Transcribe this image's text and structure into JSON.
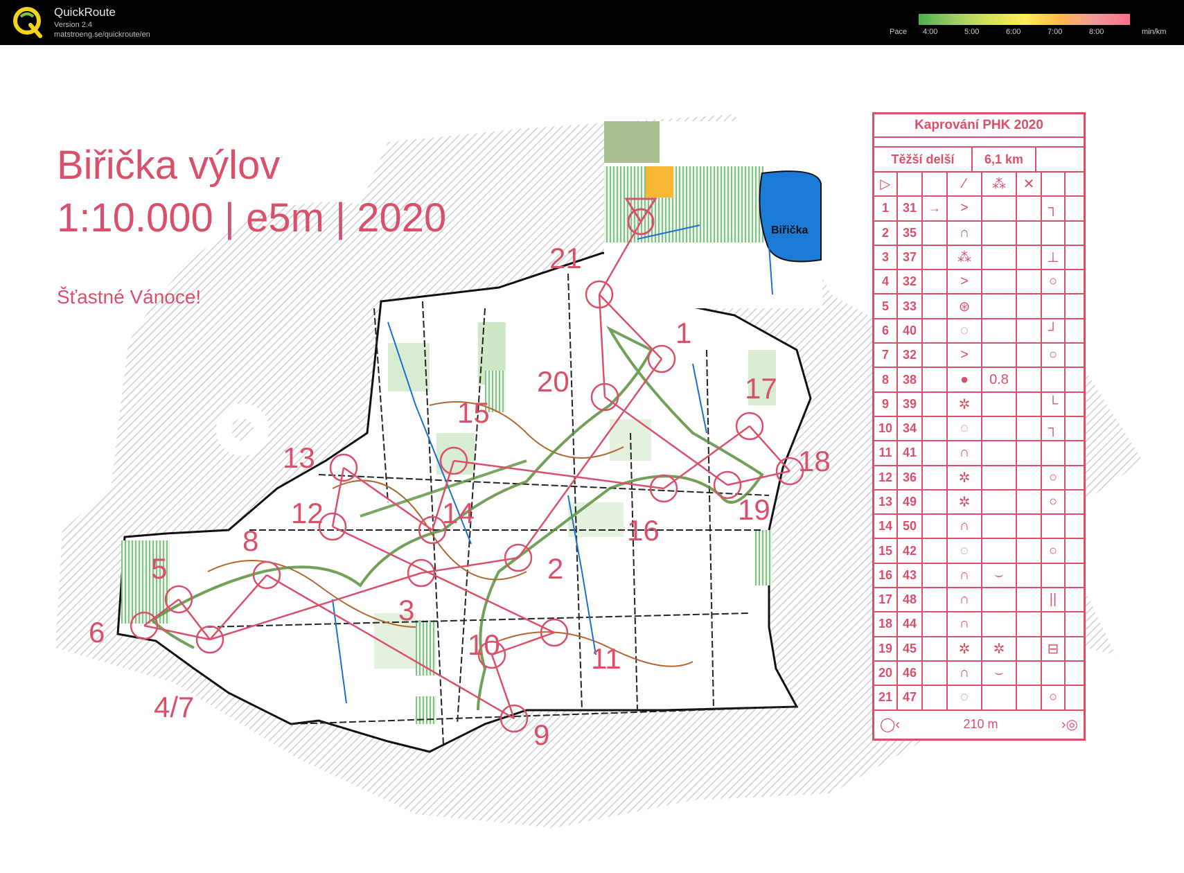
{
  "app": {
    "name": "QuickRoute",
    "version": "Version 2.4",
    "url": "matstroeng.se/quickroute/en"
  },
  "pace_scale": {
    "label": "Pace",
    "ticks": [
      "4:00",
      "5:00",
      "6:00",
      "7:00",
      "8:00"
    ],
    "unit": "min/km"
  },
  "map": {
    "title": "Biřička výlov",
    "subtitle": "1:10.000 | e5m | 2020",
    "greeting": "Šťastné Vánoce!",
    "lake_label": "Biřička",
    "control_labels": [
      "1",
      "2",
      "3",
      "4/7",
      "5",
      "6",
      "8",
      "9",
      "10",
      "11",
      "12",
      "13",
      "14",
      "15",
      "16",
      "17",
      "18",
      "19",
      "20",
      "21"
    ],
    "colors": {
      "overprint": "#d9506a",
      "route": "#5a8f3c",
      "forest": "#2f9a46",
      "water": "#1a6fd1"
    }
  },
  "description_sheet": {
    "event": "Kaprování PHK 2020",
    "class": "Těžší delší",
    "length": "6,1 km",
    "rows": [
      {
        "n": "1",
        "code": "31",
        "d": "→",
        "f": ">",
        "g": "",
        "h": "┐"
      },
      {
        "n": "2",
        "code": "35",
        "d": "",
        "f": "∩",
        "g": "",
        "h": ""
      },
      {
        "n": "3",
        "code": "37",
        "d": "",
        "f": "⁂",
        "g": "",
        "h": "⊥"
      },
      {
        "n": "4",
        "code": "32",
        "d": "",
        "f": ">",
        "g": "",
        "h": "○"
      },
      {
        "n": "5",
        "code": "33",
        "d": "",
        "f": "⊛",
        "g": "",
        "h": ""
      },
      {
        "n": "6",
        "code": "40",
        "d": "",
        "f": "◌",
        "g": "",
        "h": "┘"
      },
      {
        "n": "7",
        "code": "32",
        "d": "",
        "f": ">",
        "g": "",
        "h": "○"
      },
      {
        "n": "8",
        "code": "38",
        "d": "",
        "f": "●",
        "g": "0.8",
        "h": ""
      },
      {
        "n": "9",
        "code": "39",
        "d": "",
        "f": "✲",
        "g": "",
        "h": "└"
      },
      {
        "n": "10",
        "code": "34",
        "d": "",
        "f": "◌",
        "g": "",
        "h": "┐"
      },
      {
        "n": "11",
        "code": "41",
        "d": "",
        "f": "∩",
        "g": "",
        "h": ""
      },
      {
        "n": "12",
        "code": "36",
        "d": "",
        "f": "✲",
        "g": "",
        "h": "○"
      },
      {
        "n": "13",
        "code": "49",
        "d": "",
        "f": "✲",
        "g": "",
        "h": "○"
      },
      {
        "n": "14",
        "code": "50",
        "d": "",
        "f": "∩",
        "g": "",
        "h": ""
      },
      {
        "n": "15",
        "code": "42",
        "d": "",
        "f": "◌",
        "g": "",
        "h": "○"
      },
      {
        "n": "16",
        "code": "43",
        "d": "",
        "f": "∩",
        "g": "⌣",
        "h": ""
      },
      {
        "n": "17",
        "code": "48",
        "d": "",
        "f": "∩",
        "g": "",
        "h": "||"
      },
      {
        "n": "18",
        "code": "44",
        "d": "",
        "f": "∩",
        "g": "",
        "h": ""
      },
      {
        "n": "19",
        "code": "45",
        "d": "",
        "f": "✲",
        "g": "✲",
        "h": "⊟"
      },
      {
        "n": "20",
        "code": "46",
        "d": "",
        "f": "∩",
        "g": "⌣",
        "h": ""
      },
      {
        "n": "21",
        "code": "47",
        "d": "",
        "f": "◌",
        "g": "",
        "h": "○"
      }
    ],
    "finish": "210 m"
  }
}
